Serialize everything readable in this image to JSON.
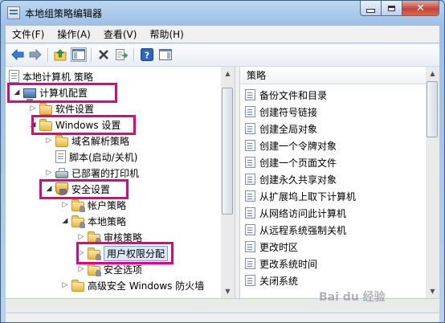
{
  "window": {
    "title": "本地组策略编辑器"
  },
  "menu": [
    "文件(F)",
    "操作(A)",
    "查看(V)",
    "帮助(H)"
  ],
  "tree": {
    "root": "本地计算机 策略",
    "computer_config": "计算机配置",
    "software_settings": "软件设置",
    "windows_settings": "Windows 设置",
    "name_resolution": "域名解析策略",
    "scripts": "脚本(启动/关机)",
    "printers": "已部署的打印机",
    "security_settings": "安全设置",
    "account_policies": "帐户策略",
    "local_policies": "本地策略",
    "audit_policy": "审核策略",
    "user_rights": "用户权限分配",
    "security_options": "安全选项",
    "firewall": "高级安全 Windows 防火墙"
  },
  "list": {
    "header": "策略",
    "items": [
      "备份文件和目录",
      "创建符号链接",
      "创建全局对象",
      "创建一个令牌对象",
      "创建一个页面文件",
      "创建永久共享对象",
      "从扩展坞上取下计算机",
      "从网络访问此计算机",
      "从远程系统强制关机",
      "更改时区",
      "更改系统时间",
      "关闭系统"
    ]
  },
  "watermark": "Bai du 经验",
  "colors": {
    "highlight": "#e6007e",
    "selection": "#d9e8fb"
  }
}
